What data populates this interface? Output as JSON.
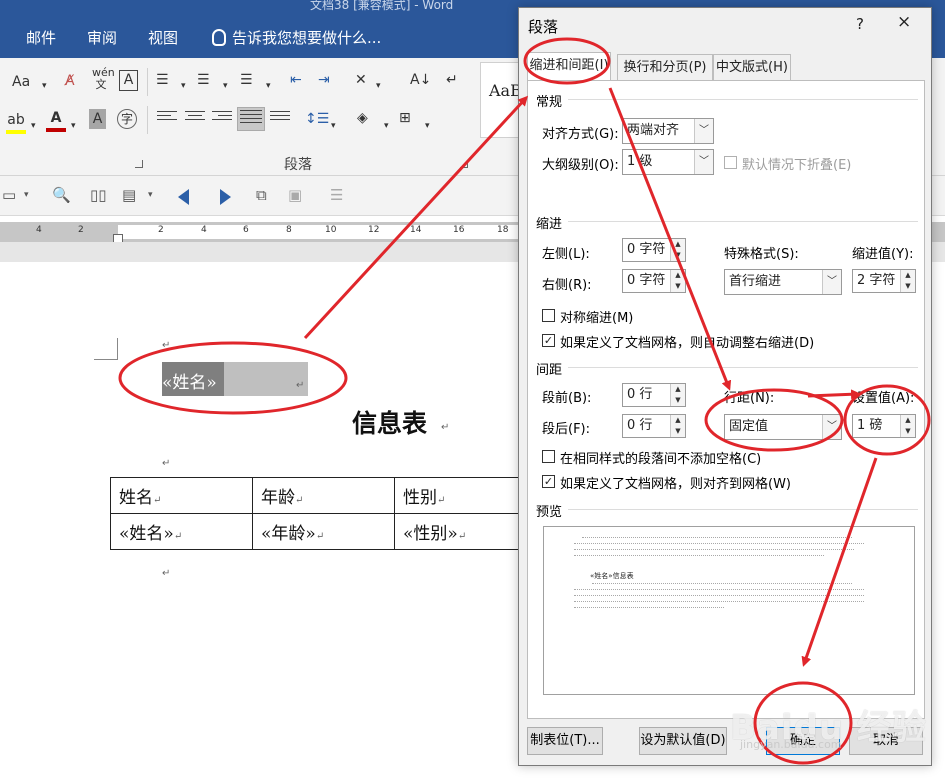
{
  "word": {
    "title": "文档38 [兼容模式] - Word",
    "menu_tabs": [
      "邮件",
      "审阅",
      "视图"
    ],
    "tell_me": "告诉我您想要做什么...",
    "ribbon_group_label": "段落",
    "style_preview": "AaB",
    "font_size_label": "Aa",
    "phonetic_label": "wén 文",
    "ruler_ticks": [
      "4",
      "2",
      "2",
      "4",
      "6",
      "8",
      "10",
      "12",
      "14",
      "16",
      "18"
    ],
    "merge_field": "«姓名»",
    "heading": "信息表",
    "table": {
      "headers": [
        "姓名",
        "年龄",
        "性别"
      ],
      "fields": [
        "«姓名»",
        "«年龄»",
        "«性别»"
      ]
    }
  },
  "dialog": {
    "title": "段落",
    "help": "?",
    "close": "×",
    "tabs": [
      "缩进和间距(I)",
      "换行和分页(P)",
      "中文版式(H)"
    ],
    "general": {
      "section": "常规",
      "alignment_label": "对齐方式(G):",
      "alignment_value": "两端对齐",
      "outline_label": "大纲级别(O):",
      "outline_value": "1 级",
      "collapse_label": "默认情况下折叠(E)"
    },
    "indent": {
      "section": "缩进",
      "left_label": "左侧(L):",
      "left_value": "0 字符",
      "right_label": "右侧(R):",
      "right_value": "0 字符",
      "special_label": "特殊格式(S):",
      "special_value": "首行缩进",
      "by_label": "缩进值(Y):",
      "by_value": "2 字符",
      "mirror_label": "对称缩进(M)",
      "auto_adjust_label": "如果定义了文档网格，则自动调整右缩进(D)"
    },
    "spacing": {
      "section": "间距",
      "before_label": "段前(B):",
      "before_value": "0 行",
      "after_label": "段后(F):",
      "after_value": "0 行",
      "line_label": "行距(N):",
      "line_value": "固定值",
      "at_label": "设置值(A):",
      "at_value": "1 磅",
      "no_space_label": "在相同样式的段落间不添加空格(C)",
      "snap_grid_label": "如果定义了文档网格，则对齐到网格(W)"
    },
    "preview": {
      "section": "预览",
      "sample": "«姓名»信息表"
    },
    "buttons": {
      "tabs": "制表位(T)...",
      "default": "设为默认值(D)",
      "ok": "确定",
      "cancel": "取消"
    }
  },
  "annotation": {
    "color": "#e0262b",
    "watermark": "Baidu 经验",
    "watermark_sub": "jingyan.baidu.com"
  }
}
